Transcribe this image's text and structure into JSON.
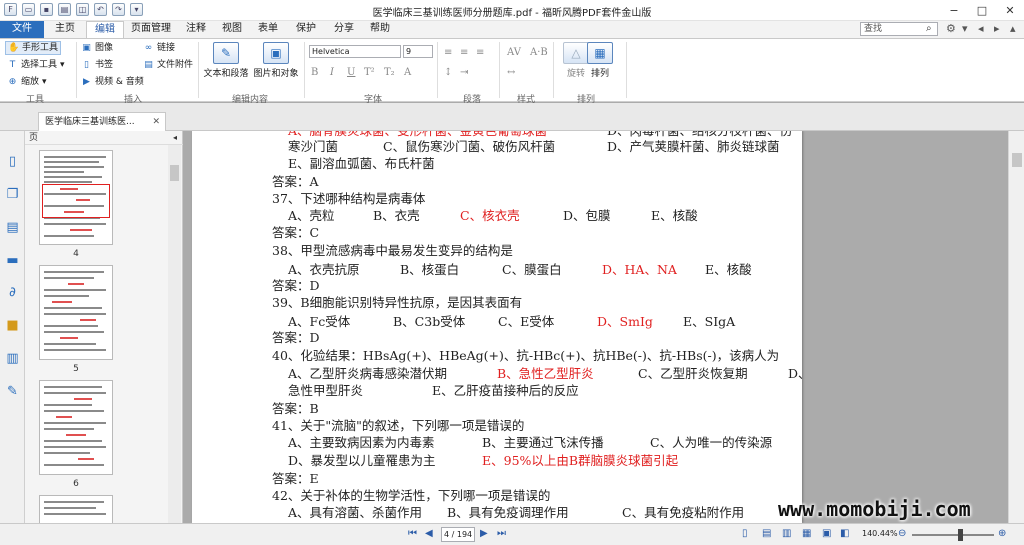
{
  "window": {
    "title": "医学临床三基训练医师分册题库.pdf - 福昕风腾PDF套件金山版",
    "controls": [
      "−",
      "□",
      "✕"
    ]
  },
  "quick_access": [
    "folder-open-icon",
    "save-icon",
    "print-icon",
    "screenshot-icon",
    "undo-icon",
    "redo-icon",
    "customize-icon"
  ],
  "ribbon_tabs": [
    {
      "label": "文件"
    },
    {
      "label": "主页"
    },
    {
      "label": "编辑"
    },
    {
      "label": "页面管理"
    },
    {
      "label": "注释"
    },
    {
      "label": "视图"
    },
    {
      "label": "表单"
    },
    {
      "label": "保护"
    },
    {
      "label": "分享"
    },
    {
      "label": "帮助"
    }
  ],
  "active_tab": "编辑",
  "search": {
    "placeholder": "查找"
  },
  "ribbon": {
    "tools_group": {
      "label": "工具",
      "hand": "手形工具",
      "select": "选择工具",
      "zoom": "缩放"
    },
    "insert_group": {
      "label": "插入",
      "image": "图像",
      "bookmark": "书签",
      "video_audio": "视频 & 音频",
      "link": "链接",
      "attachment": "文件附件"
    },
    "edit_group": {
      "label": "编辑内容",
      "text_para": "文本和段落",
      "image_obj": "图片和对象"
    },
    "font_group": {
      "label": "字体",
      "font_name": "Helvetica",
      "font_size": "9"
    },
    "paragraph_group": {
      "label": "段落"
    },
    "style_group": {
      "label": "样式"
    },
    "arrange_group": {
      "label": "排列",
      "rotate": "旋转",
      "arrange": "排列"
    }
  },
  "document_tab": {
    "title": "医学临床三基训练医..."
  },
  "thumbnails": {
    "header": "页",
    "pages": [
      {
        "number": "4"
      },
      {
        "number": "5"
      },
      {
        "number": "6"
      }
    ]
  },
  "document": {
    "top_partial": {
      "a": "A、脑脊膜炎球菌、变形杆菌、金黄色葡萄球菌",
      "d": "D、肉毒杆菌、结核分枝杆菌、伤",
      "line2a": "寒沙门菌",
      "c": "C、鼠伤寒沙门菌、破伤风杆菌",
      "d2": "D、产气荚膜杆菌、肺炎链球菌",
      "e": "E、副溶血弧菌、布氏杆菌",
      "answer": "答案：A"
    },
    "q37": {
      "question": "37、下述哪种结构是病毒体",
      "a": "A、壳粒",
      "b": "B、衣壳",
      "c": "C、核衣壳",
      "d": "D、包膜",
      "e": "E、核酸",
      "answer": "答案：C"
    },
    "q38": {
      "question": "38、甲型流感病毒中最易发生变异的结构是",
      "a": "A、衣壳抗原",
      "b": "B、核蛋白",
      "c": "C、膜蛋白",
      "d": "D、HA、NA",
      "e": "E、核酸",
      "answer": "答案：D"
    },
    "q39": {
      "question": "39、B细胞能识别特异性抗原，是因其表面有",
      "a": "A、Fc受体",
      "b": "B、C3b受体",
      "c": "C、E受体",
      "d": "D、SmIg",
      "e": "E、SIgA",
      "answer": "答案：D"
    },
    "q40": {
      "question": "40、化验结果：HBsAg(+)、HBeAg(+)、抗-HBc(+)、抗HBe(-)、抗-HBs(-)，该病人为",
      "a": "A、乙型肝炎病毒感染潜伏期",
      "b": "B、急性乙型肝炎",
      "c": "C、乙型肝炎恢复期",
      "d": "D、",
      "d_cont": "急性甲型肝炎",
      "e": "E、乙肝疫苗接种后的反应",
      "answer": "答案：B"
    },
    "q41": {
      "question": "41、关于\"流脑\"的叙述，下列哪一项是错误的",
      "a": "A、主要致病因素为内毒素",
      "b": "B、主要通过飞沫传播",
      "c": "C、人为唯一的传染源",
      "d": "D、暴发型以儿童罹患为主",
      "e": "E、95%以上由B群脑膜炎球菌引起",
      "answer": "答案：E"
    },
    "q42": {
      "question": "42、关于补体的生物学活性，下列哪一项是错误的",
      "a": "A、具有溶菌、杀菌作用",
      "b": "B、具有免疫调理作用",
      "c": "C、具有免疫粘附作用"
    }
  },
  "status": {
    "page_indicator": "4 / 194",
    "zoom": "140.44%"
  },
  "watermark": "www.momobiji.com"
}
